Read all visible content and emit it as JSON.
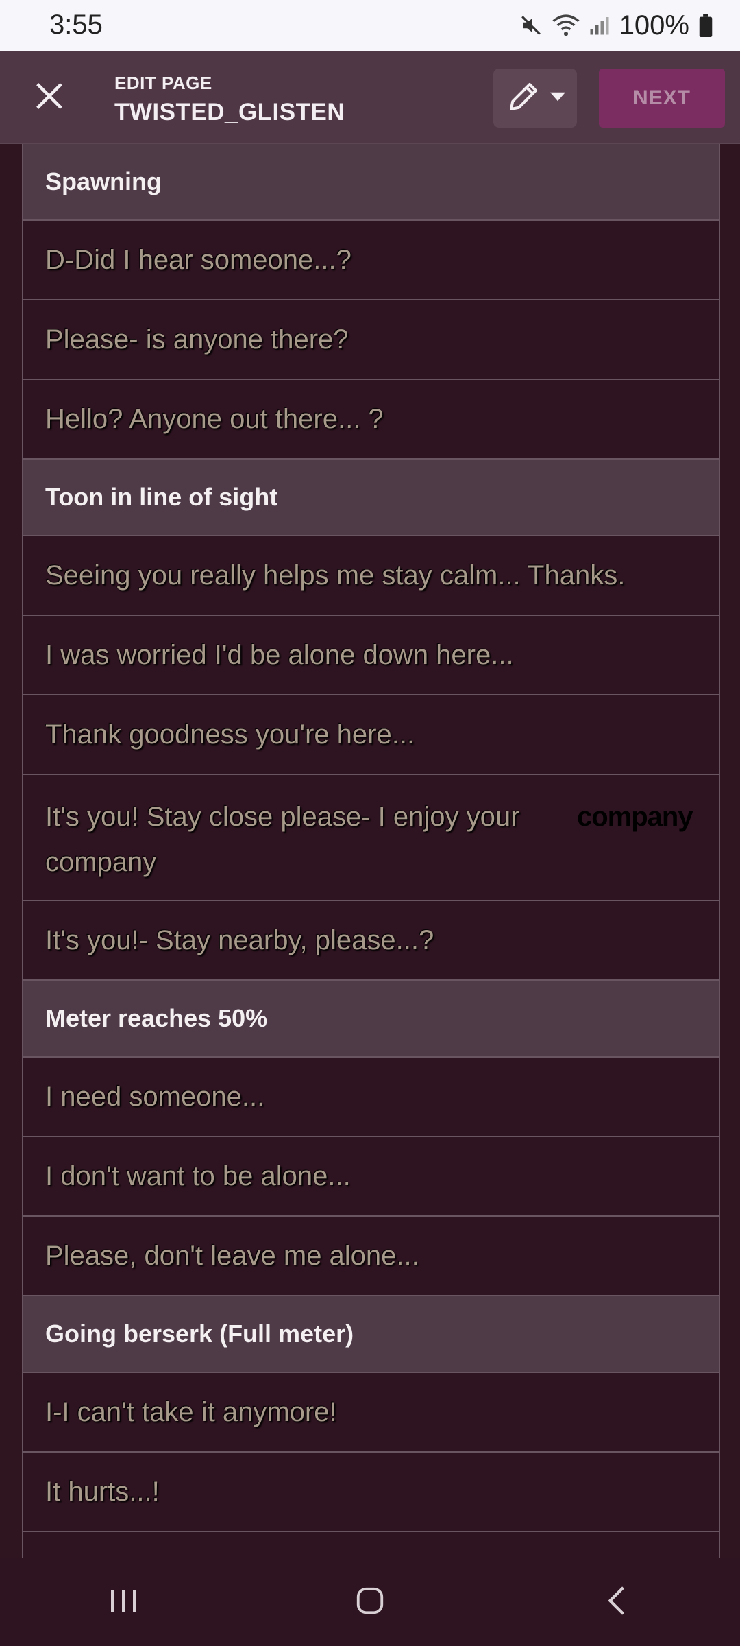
{
  "status_bar": {
    "time": "3:55",
    "battery": "100%",
    "icons": [
      "mute-icon",
      "wifi-icon",
      "signal-icon",
      "battery-icon"
    ]
  },
  "header": {
    "eyebrow": "EDIT PAGE",
    "title": "TWISTED_GLISTEN",
    "next_label": "NEXT",
    "icons": [
      "close-icon",
      "pencil-icon",
      "caret-down-icon"
    ]
  },
  "list": {
    "sections": [
      {
        "title": "Spawning",
        "lines": [
          "D-Did I hear someone...?",
          "Please- is anyone there?",
          "Hello? Anyone out there... ?"
        ]
      },
      {
        "title": "Toon in line of sight",
        "lines": [
          "Seeing you really helps me stay calm... Thanks.",
          "I was worried I'd be alone down here...",
          "Thank goodness you're here...",
          "It's you! Stay close please- I enjoy your company",
          "It's you!- Stay nearby, please...?"
        ],
        "overlay_word": "company"
      },
      {
        "title": "Meter reaches 50%",
        "lines": [
          "I need someone...",
          "I don't want to be alone...",
          "Please, don't leave me alone..."
        ]
      },
      {
        "title": "Going berserk (Full meter)",
        "lines": [
          "I-I can't take it anymore!",
          "It hurts...!"
        ]
      }
    ]
  },
  "nav_bar": {
    "icons": [
      "recent-apps-icon",
      "home-icon",
      "back-icon"
    ]
  },
  "colors": {
    "header_bg": "#4f3746",
    "list_bg": "#2e1420",
    "section_bg": "#4f3a48",
    "next_button": "#7b2d61",
    "item_text": "#a89a8a"
  }
}
